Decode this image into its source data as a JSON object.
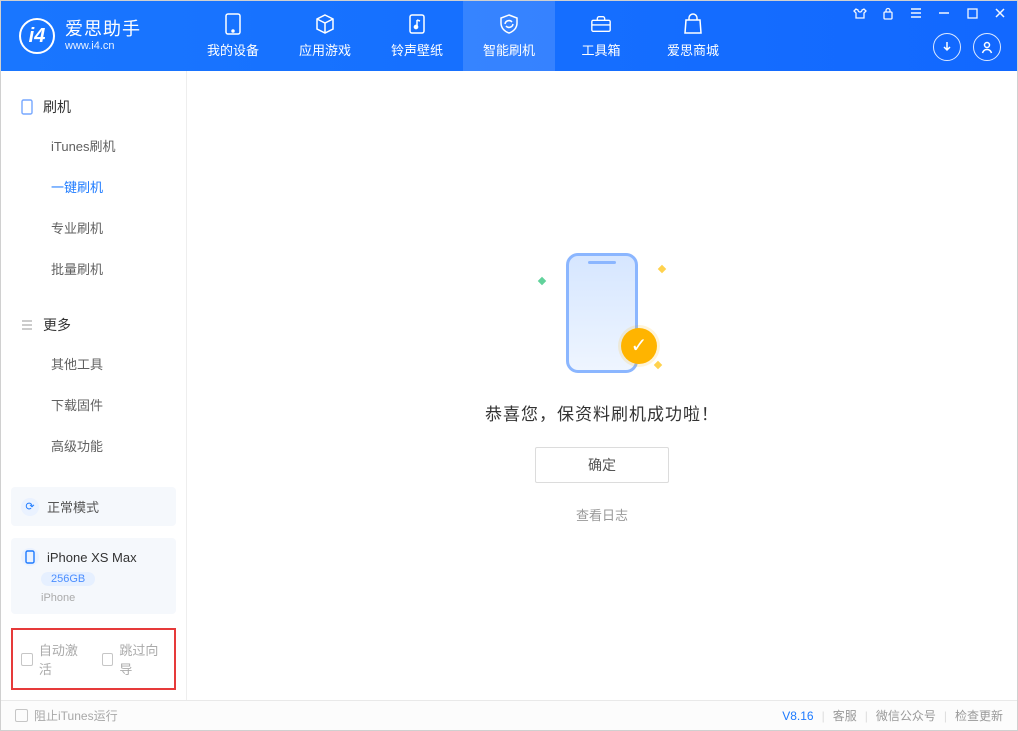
{
  "brand": {
    "title": "爱思助手",
    "subtitle": "www.i4.cn"
  },
  "nav": {
    "items": [
      {
        "label": "我的设备"
      },
      {
        "label": "应用游戏"
      },
      {
        "label": "铃声壁纸"
      },
      {
        "label": "智能刷机"
      },
      {
        "label": "工具箱"
      },
      {
        "label": "爱思商城"
      }
    ]
  },
  "sidebar": {
    "section_flash": {
      "title": "刷机",
      "items": [
        {
          "label": "iTunes刷机"
        },
        {
          "label": "一键刷机"
        },
        {
          "label": "专业刷机"
        },
        {
          "label": "批量刷机"
        }
      ]
    },
    "section_more": {
      "title": "更多",
      "items": [
        {
          "label": "其他工具"
        },
        {
          "label": "下载固件"
        },
        {
          "label": "高级功能"
        }
      ]
    }
  },
  "status": {
    "mode_label": "正常模式",
    "device_name": "iPhone XS Max",
    "device_capacity": "256GB",
    "device_type": "iPhone"
  },
  "options": {
    "auto_activate_label": "自动激活",
    "skip_guide_label": "跳过向导"
  },
  "main": {
    "success_text": "恭喜您，保资料刷机成功啦！",
    "confirm_label": "确定",
    "view_log_label": "查看日志"
  },
  "footer": {
    "block_itunes_label": "阻止iTunes运行",
    "version": "V8.16",
    "support_label": "客服",
    "wechat_label": "微信公众号",
    "check_update_label": "检查更新"
  }
}
